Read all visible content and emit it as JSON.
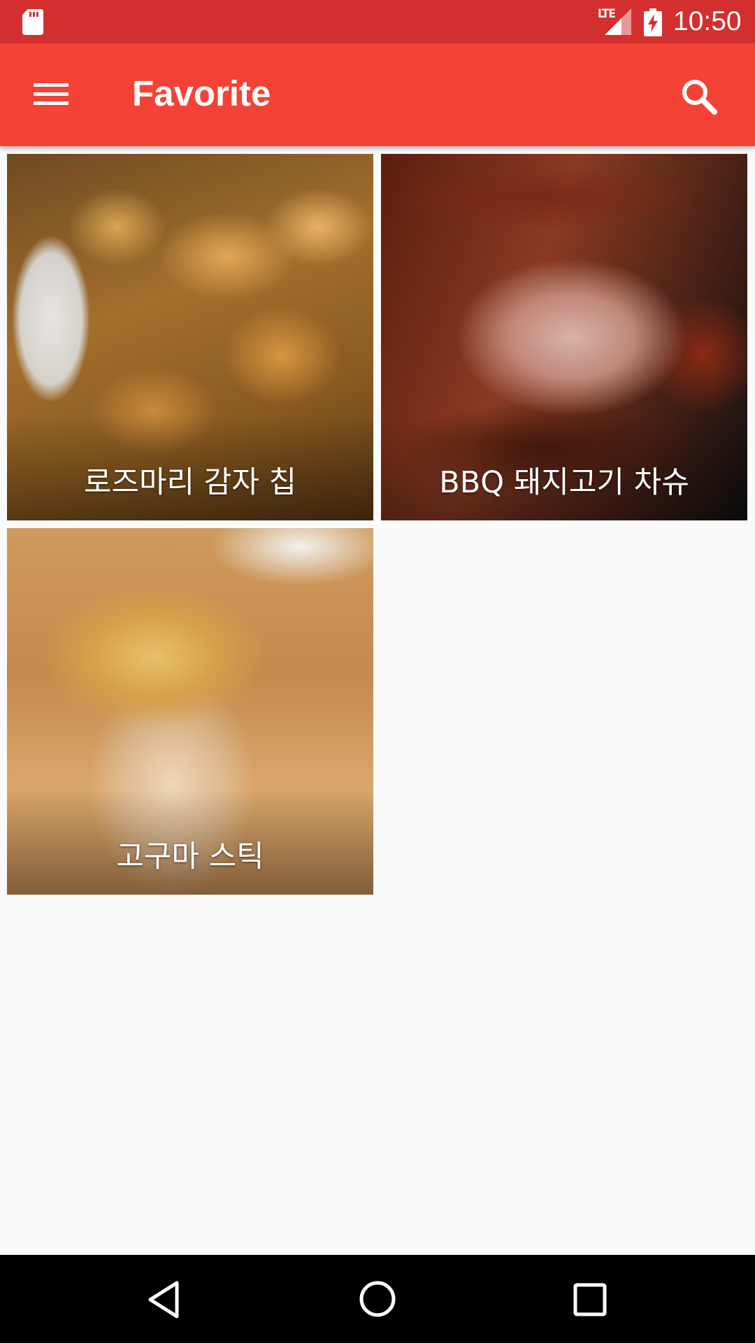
{
  "status_bar": {
    "network": "LTE",
    "time": "10:50",
    "icons": [
      "sd-card-icon",
      "lte-signal-icon",
      "battery-charging-icon"
    ]
  },
  "app_bar": {
    "title": "Favorite",
    "menu_icon": "menu-icon",
    "search_icon": "search-icon"
  },
  "favorites": [
    {
      "label": "로즈마리 감자 칩",
      "image": "potato-chips-photo"
    },
    {
      "label": "BBQ 돼지고기 차슈",
      "image": "bbq-pork-chashu-photo"
    },
    {
      "label": "고구마 스틱",
      "image": "sweet-potato-sticks-photo"
    }
  ],
  "nav_bar": {
    "icons": [
      "back-icon",
      "home-icon",
      "recent-apps-icon"
    ]
  },
  "colors": {
    "status_bar": "#d32f2f",
    "app_bar": "#f44336",
    "background": "#fafafa",
    "nav_bar": "#000000"
  }
}
